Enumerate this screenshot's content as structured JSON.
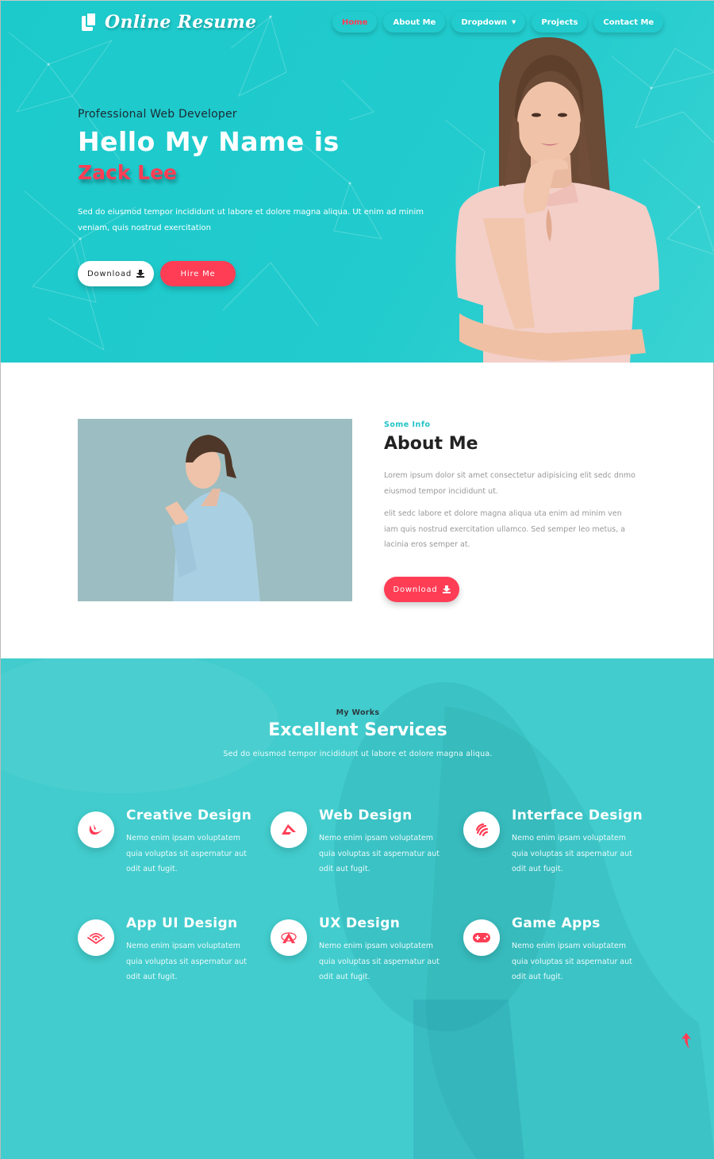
{
  "header": {
    "logo_text": "Online Resume",
    "nav": [
      {
        "label": "Home",
        "active": true
      },
      {
        "label": "About Me",
        "active": false
      },
      {
        "label": "Dropdown",
        "active": false,
        "has_caret": true
      },
      {
        "label": "Projects",
        "active": false
      },
      {
        "label": "Contact Me",
        "active": false
      }
    ]
  },
  "hero": {
    "subtitle": "Professional Web Developer",
    "heading": "Hello My Name is",
    "name": "Zack Lee",
    "description": "Sed do eiusmod tempor incididunt ut labore et dolore magna aliqua. Ut enim ad minim veniam, quis nostrud exercitation",
    "download_label": "Download",
    "hire_label": "Hire Me"
  },
  "about": {
    "kicker": "Some Info",
    "title": "About Me",
    "paragraph1": "Lorem ipsum dolor sit amet consectetur adipisicing elit sedc dnmo eiusmod tempor incididunt ut.",
    "paragraph2": "elit sedc labore et dolore magna aliqua uta enim ad minim ven iam quis nostrud exercitation ullamco. Sed semper leo metus, a lacinia eros semper at.",
    "download_label": "Download"
  },
  "services": {
    "kicker": "My Works",
    "title": "Excellent Services",
    "subtitle": "Sed do eiusmod tempor incididunt ut labore et dolore magna aliqua.",
    "items": [
      {
        "title": "Creative Design",
        "icon": "creative-icon",
        "description": "Nemo enim ipsam voluptatem quia voluptas sit aspernatur aut odit aut fugit."
      },
      {
        "title": "Web Design",
        "icon": "web-design-icon",
        "description": "Nemo enim ipsam voluptatem quia voluptas sit aspernatur aut odit aut fugit."
      },
      {
        "title": "Interface Design",
        "icon": "interface-icon",
        "description": "Nemo enim ipsam voluptatem quia voluptas sit aspernatur aut odit aut fugit."
      },
      {
        "title": "App UI Design",
        "icon": "app-ui-icon",
        "description": "Nemo enim ipsam voluptatem quia voluptas sit aspernatur aut odit aut fugit."
      },
      {
        "title": "UX Design",
        "icon": "ux-icon",
        "description": "Nemo enim ipsam voluptatem quia voluptas sit aspernatur aut odit aut fugit."
      },
      {
        "title": "Game Apps",
        "icon": "gamepad-icon",
        "description": "Nemo enim ipsam voluptatem quia voluptas sit aspernatur aut odit aut fugit."
      }
    ]
  },
  "colors": {
    "teal": "#1ccacc",
    "accent_red": "#ff3d55",
    "services_bg": "#42cccd"
  }
}
